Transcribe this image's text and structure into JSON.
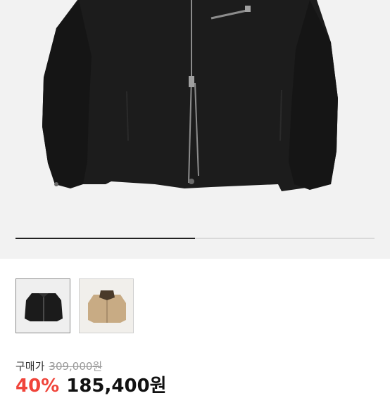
{
  "product": {
    "gallery": {
      "image_name": "black-jacket-image",
      "progress_fraction": 0.5
    },
    "thumbnails": [
      {
        "name": "black",
        "selected": true,
        "color": "#1b1b1b"
      },
      {
        "name": "beige",
        "selected": false,
        "color": "#c8ab84"
      }
    ],
    "price": {
      "label": "구매가",
      "original": "309,000원",
      "discount": "40%",
      "sale": "185,400원"
    }
  },
  "colors": {
    "accent_red": "#f0443a",
    "jacket_black": "#1b1b1b",
    "jacket_beige": "#c8ab84"
  }
}
